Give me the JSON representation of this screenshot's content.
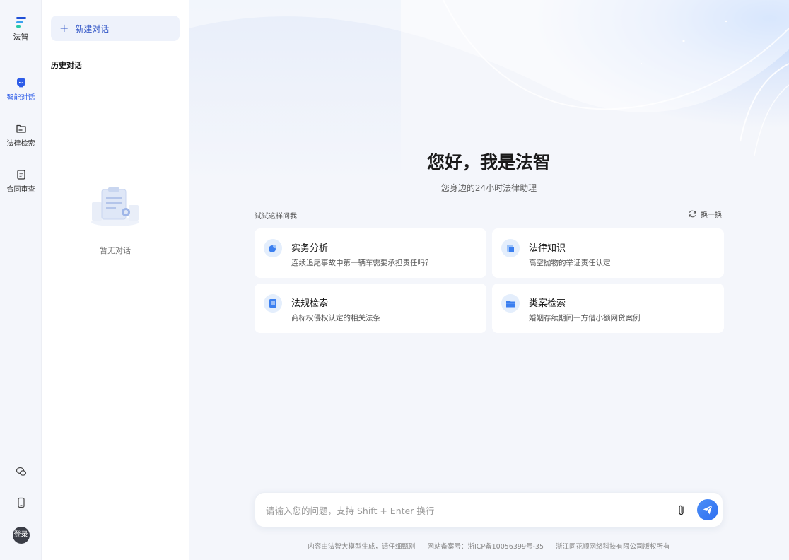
{
  "app": {
    "logo_text": "法智"
  },
  "rail": {
    "items": [
      {
        "label": "智能对话",
        "icon": "chat-icon",
        "active": true
      },
      {
        "label": "法律检索",
        "icon": "folder-icon",
        "active": false
      },
      {
        "label": "合同审查",
        "icon": "document-icon",
        "active": false
      }
    ],
    "bottom": {
      "wechat_icon": "wechat-icon",
      "mobile_icon": "mobile-icon",
      "login_label": "登录"
    }
  },
  "history": {
    "new_chat_label": "新建对话",
    "title": "历史对话",
    "empty_text": "暂无对话"
  },
  "main": {
    "greeting": "您好，我是法智",
    "subtitle": "您身边的24小时法律助理",
    "try_label": "试试这样问我",
    "refresh_label": "换一换",
    "cards": [
      {
        "title": "实务分析",
        "desc": "连续追尾事故中第一辆车需要承担责任吗？"
      },
      {
        "title": "法律知识",
        "desc": "高空抛物的举证责任认定"
      },
      {
        "title": "法规检索",
        "desc": "商标权侵权认定的相关法条"
      },
      {
        "title": "类案检索",
        "desc": "婚姻存续期间一方借小额网贷案例"
      }
    ],
    "input": {
      "placeholder": "请输入您的问题，支持 Shift + Enter 换行",
      "value": ""
    }
  },
  "footer": {
    "notice": "内容由法智大模型生成，请仔细甄别",
    "icp": "网站备案号：浙ICP备10056399号-35",
    "copyright": "浙江同花顺网络科技有限公司版权所有"
  },
  "colors": {
    "accent": "#2d5ce8",
    "send_button": "#3a7cf4"
  }
}
